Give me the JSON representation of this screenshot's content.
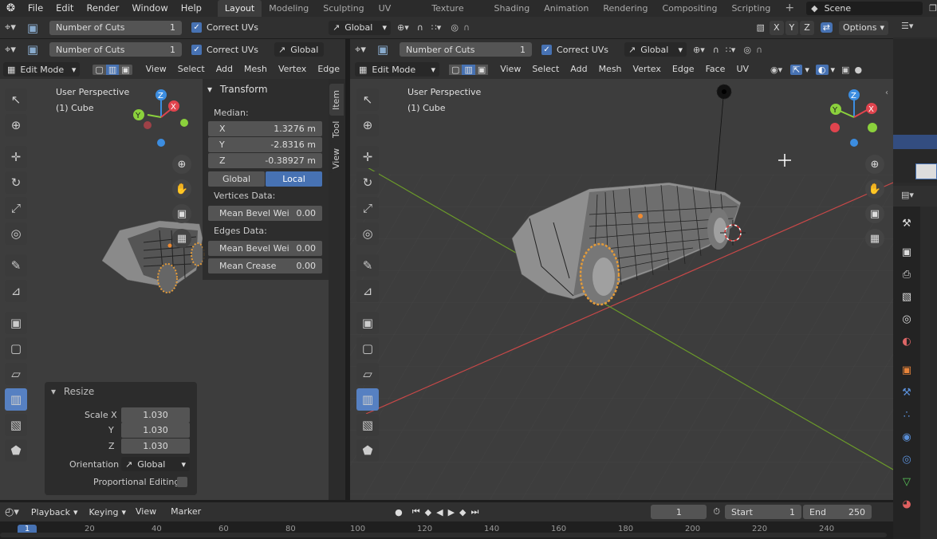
{
  "menu": {
    "items": [
      "File",
      "Edit",
      "Render",
      "Window",
      "Help"
    ]
  },
  "workspaces": {
    "tabs": [
      "Layout",
      "Modeling",
      "Sculpting",
      "UV Editing",
      "Texture Paint",
      "Shading",
      "Animation",
      "Rendering",
      "Compositing",
      "Scripting"
    ],
    "active": "Layout",
    "add": "+"
  },
  "scene": {
    "name": "Scene"
  },
  "top_tool_header": {
    "cuts_label": "Number of Cuts",
    "cuts_value": "1",
    "correct_uvs": "Correct UVs",
    "orientation": "Global",
    "options": "Options",
    "axes": [
      "X",
      "Y",
      "Z"
    ]
  },
  "left_view": {
    "tool_header": {
      "cuts_label": "Number of Cuts",
      "cuts_value": "1",
      "correct_uvs": "Correct UVs",
      "orientation": "Global"
    },
    "mode": "Edit Mode",
    "menus": [
      "View",
      "Select",
      "Add",
      "Mesh",
      "Vertex",
      "Edge"
    ],
    "overlay": {
      "perspective": "User Perspective",
      "object": "(1) Cube"
    },
    "transform": {
      "title": "Transform",
      "median_label": "Median:",
      "x_label": "X",
      "x": "1.3276 m",
      "y_label": "Y",
      "y": "-2.8316 m",
      "z_label": "Z",
      "z": "-0.38927 m",
      "global": "Global",
      "local": "Local",
      "vertices_data": "Vertices Data:",
      "mean_bevel_weight_v": "Mean Bevel Wei",
      "mean_bevel_weight_v_val": "0.00",
      "edges_data": "Edges Data:",
      "mean_bevel_weight_e": "Mean Bevel Wei",
      "mean_bevel_weight_e_val": "0.00",
      "mean_crease": "Mean Crease",
      "mean_crease_val": "0.00"
    },
    "side_tabs": [
      "Item",
      "Tool",
      "View"
    ],
    "resize": {
      "title": "Resize",
      "scale_x_label": "Scale X",
      "scale_x": "1.030",
      "y_label": "Y",
      "y": "1.030",
      "z_label": "Z",
      "z": "1.030",
      "orientation_label": "Orientation",
      "orientation": "Global",
      "proportional": "Proportional Editing"
    }
  },
  "right_view": {
    "tool_header": {
      "cuts_label": "Number of Cuts",
      "cuts_value": "1",
      "correct_uvs": "Correct UVs",
      "orientation": "Global"
    },
    "mode": "Edit Mode",
    "menus": [
      "View",
      "Select",
      "Add",
      "Mesh",
      "Vertex",
      "Edge",
      "Face",
      "UV"
    ],
    "overlay": {
      "perspective": "User Perspective",
      "object": "(1) Cube"
    }
  },
  "timeline": {
    "menus": [
      "Playback",
      "Keying",
      "View",
      "Marker"
    ],
    "current_frame": "1",
    "start_label": "Start",
    "start": "1",
    "end_label": "End",
    "end": "250",
    "ticks": [
      "20",
      "40",
      "60",
      "80",
      "100",
      "120",
      "140",
      "160",
      "180",
      "200",
      "220",
      "240"
    ],
    "playhead": "1"
  },
  "properties_icons": [
    "tool-icon",
    "render-icon",
    "output-icon",
    "view-layer-icon",
    "scene-icon",
    "world-icon",
    "object-icon",
    "modifier-icon",
    "particles-icon",
    "physics-icon",
    "constraints-icon",
    "data-icon",
    "material-icon"
  ],
  "colors": {
    "accent": "#4772b3",
    "active_tool": "#5680c2",
    "x_axis": "#e0444e",
    "y_axis": "#8bd13c",
    "z_axis": "#3c8de0"
  }
}
